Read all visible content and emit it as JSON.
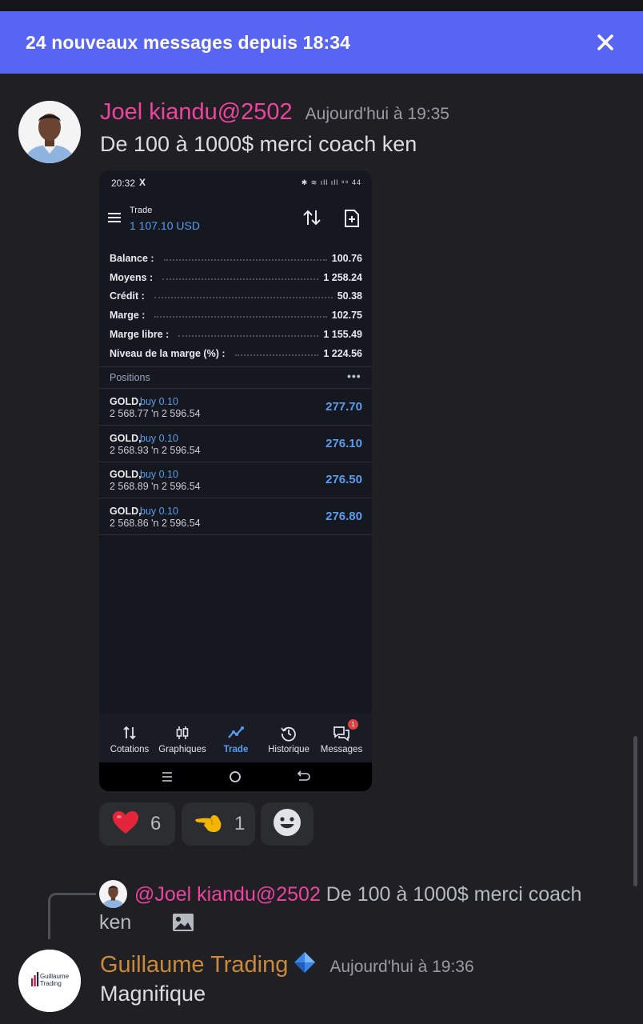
{
  "banner": {
    "text": "24 nouveaux messages depuis 18:34",
    "close_icon": "close-icon"
  },
  "message1": {
    "username": "Joel kiandu@2502",
    "username_color": "#eb459e",
    "timestamp": "Aujourd'hui à 19:35",
    "text": "De 100 à 1000$ merci coach ken",
    "attachment": {
      "status_time": "20:32",
      "status_x": "X",
      "status_icons": "✱ ≋ ıll ıll ⁹⁹ 44",
      "header_label": "Trade",
      "header_amount": "1 107.10 USD",
      "summary": [
        {
          "label": "Balance :",
          "value": "100.76"
        },
        {
          "label": "Moyens :",
          "value": "1 258.24"
        },
        {
          "label": "Crédit :",
          "value": "50.38"
        },
        {
          "label": "Marge :",
          "value": "102.75"
        },
        {
          "label": "Marge libre :",
          "value": "1 155.49"
        },
        {
          "label": "Niveau de la marge (%) :",
          "value": "1 224.56"
        }
      ],
      "positions_header": "Positions",
      "positions_more": "•••",
      "positions": [
        {
          "symbol": "GOLD,",
          "side": "buy 0.10",
          "prices": "2 568.77 'n 2 596.54",
          "profit": "277.70"
        },
        {
          "symbol": "GOLD,",
          "side": "buy 0.10",
          "prices": "2 568.93 'n 2 596.54",
          "profit": "276.10"
        },
        {
          "symbol": "GOLD,",
          "side": "buy 0.10",
          "prices": "2 568.89 'n 2 596.54",
          "profit": "276.50"
        },
        {
          "symbol": "GOLD,",
          "side": "buy 0.10",
          "prices": "2 568.86 'n 2 596.54",
          "profit": "276.80"
        }
      ],
      "nav": [
        {
          "label": "Cotations",
          "icon": "arrows-updown-icon"
        },
        {
          "label": "Graphiques",
          "icon": "candlestick-icon"
        },
        {
          "label": "Trade",
          "icon": "trend-line-icon",
          "active": true
        },
        {
          "label": "Historique",
          "icon": "history-icon"
        },
        {
          "label": "Messages",
          "icon": "chat-icon",
          "badge": "1"
        }
      ],
      "accent_color": "#5a9cf0"
    },
    "reactions": [
      {
        "emoji": "heart",
        "count": "6"
      },
      {
        "emoji": "pointing-hand",
        "count": "1"
      }
    ],
    "add_reaction_icon": "emoji-add-icon"
  },
  "message2": {
    "reply": {
      "mention": "@Joel kiandu@2502",
      "text": " De 100 à 1000$ merci coach ken",
      "image_icon": "image-icon"
    },
    "username": "Guillaume Trading",
    "username_color": "#c98a3c",
    "timestamp": "Aujourd'hui à 19:36",
    "text": "Magnifique",
    "avatar_logo_line1": "Guillaume",
    "avatar_logo_line2": "Trading"
  }
}
